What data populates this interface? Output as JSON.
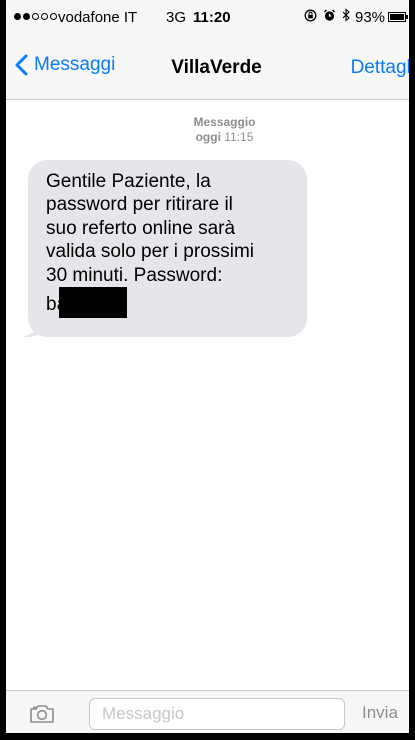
{
  "status_bar": {
    "signal_dots_filled": 2,
    "signal_dots_total": 5,
    "carrier": "vodafone IT",
    "network": "3G",
    "time": "11:20",
    "battery_percent": "93%",
    "icons": [
      "rotation-lock-icon",
      "alarm-icon",
      "bluetooth-icon",
      "battery-icon"
    ]
  },
  "nav": {
    "back_label": "Messaggi",
    "title": "VillaVerde",
    "details_label": "Dettagli"
  },
  "conversation": {
    "timestamp_label": "Messaggio",
    "timestamp_day": "oggi",
    "timestamp_time": "11:15",
    "message_lines": [
      "Gentile Paziente, la",
      "password per ritirare il",
      "suo referto online sarà",
      "valida solo per i prossimi",
      "30 minuti. Password:"
    ],
    "password_visible": "ba"
  },
  "input_bar": {
    "placeholder": "Messaggio",
    "value": "",
    "send_label": "Invia"
  },
  "colors": {
    "accent": "#0a7aff",
    "bubble": "#e5e5ea",
    "bar_background": "#f7f7f7",
    "muted_text": "#8e8e93"
  }
}
